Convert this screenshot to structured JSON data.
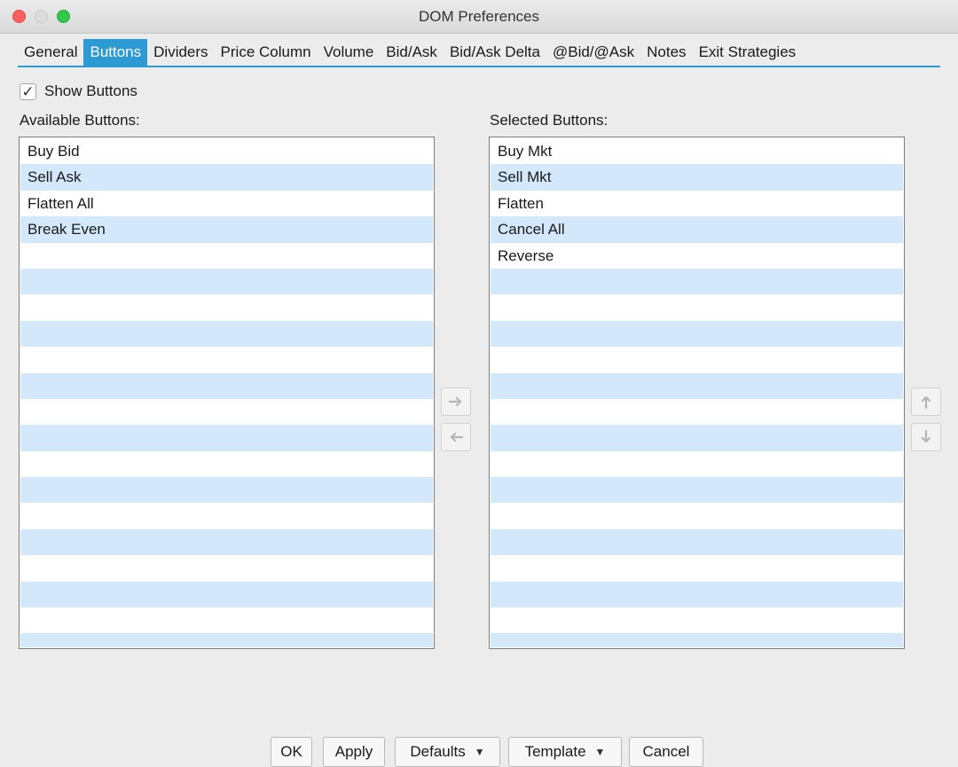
{
  "window": {
    "title": "DOM Preferences"
  },
  "tabs": [
    {
      "label": "General",
      "active": false
    },
    {
      "label": "Buttons",
      "active": true
    },
    {
      "label": "Dividers",
      "active": false
    },
    {
      "label": "Price Column",
      "active": false
    },
    {
      "label": "Volume",
      "active": false
    },
    {
      "label": "Bid/Ask",
      "active": false
    },
    {
      "label": "Bid/Ask Delta",
      "active": false
    },
    {
      "label": "@Bid/@Ask",
      "active": false
    },
    {
      "label": "Notes",
      "active": false
    },
    {
      "label": "Exit Strategies",
      "active": false
    }
  ],
  "show_buttons": {
    "label": "Show Buttons",
    "checked": true
  },
  "available": {
    "label": "Available Buttons:",
    "items": [
      "Buy Bid",
      "Sell Ask",
      "Flatten All",
      "Break Even"
    ]
  },
  "selected": {
    "label": "Selected Buttons:",
    "items": [
      "Buy Mkt",
      "Sell Mkt",
      "Flatten",
      "Cancel All",
      "Reverse"
    ]
  },
  "footer": {
    "ok": "OK",
    "apply": "Apply",
    "defaults": "Defaults",
    "template": "Template",
    "cancel": "Cancel"
  },
  "colors": {
    "accent": "#2d9ad4",
    "row_alt": "#d3e8fb"
  },
  "icons": {
    "move_right": "arrow-right-icon",
    "move_left": "arrow-left-icon",
    "move_up": "arrow-up-icon",
    "move_down": "arrow-down-icon",
    "dropdown": "caret-down-icon",
    "checkmark": "checkmark-icon"
  }
}
